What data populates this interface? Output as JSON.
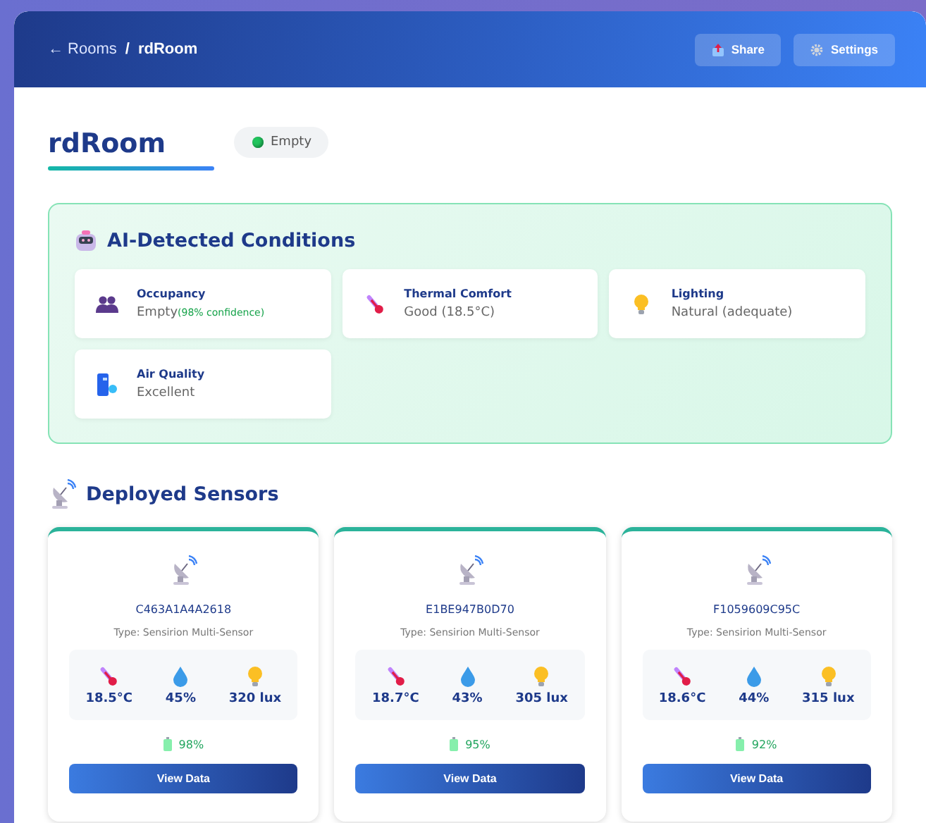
{
  "breadcrumb": {
    "back": "← Rooms",
    "separator": "/",
    "current": "rdRoom"
  },
  "header_buttons": [
    {
      "kind": "share",
      "label": "Share"
    },
    {
      "kind": "settings",
      "label": "Settings"
    }
  ],
  "room": {
    "title": "rdRoom",
    "status": "Empty"
  },
  "conditions": {
    "title": "AI-Detected Conditions",
    "items": [
      {
        "kind": "occupancy",
        "label": "Occupancy",
        "value": "Empty",
        "note": "(98% confidence)"
      },
      {
        "kind": "thermal",
        "label": "Thermal Comfort",
        "value": "Good (18.5°C)"
      },
      {
        "kind": "lighting",
        "label": "Lighting",
        "value": "Natural (adequate)"
      },
      {
        "kind": "air",
        "label": "Air Quality",
        "value": "Excellent"
      }
    ]
  },
  "sensors": {
    "title": "Deployed Sensors",
    "items": [
      {
        "id": "C463A1A4A2618",
        "type": "Type: Sensirion Multi-Sensor",
        "temperature": "18.5°C",
        "humidity": "45%",
        "light": "320 lux",
        "battery": "98%",
        "button": "View Data"
      },
      {
        "id": "E1BE947B0D70",
        "type": "Type: Sensirion Multi-Sensor",
        "temperature": "18.7°C",
        "humidity": "43%",
        "light": "305 lux",
        "battery": "95%",
        "button": "View Data"
      },
      {
        "id": "F1059609C95C",
        "type": "Type: Sensirion Multi-Sensor",
        "temperature": "18.6°C",
        "humidity": "44%",
        "light": "315 lux",
        "battery": "92%",
        "button": "View Data"
      }
    ]
  }
}
